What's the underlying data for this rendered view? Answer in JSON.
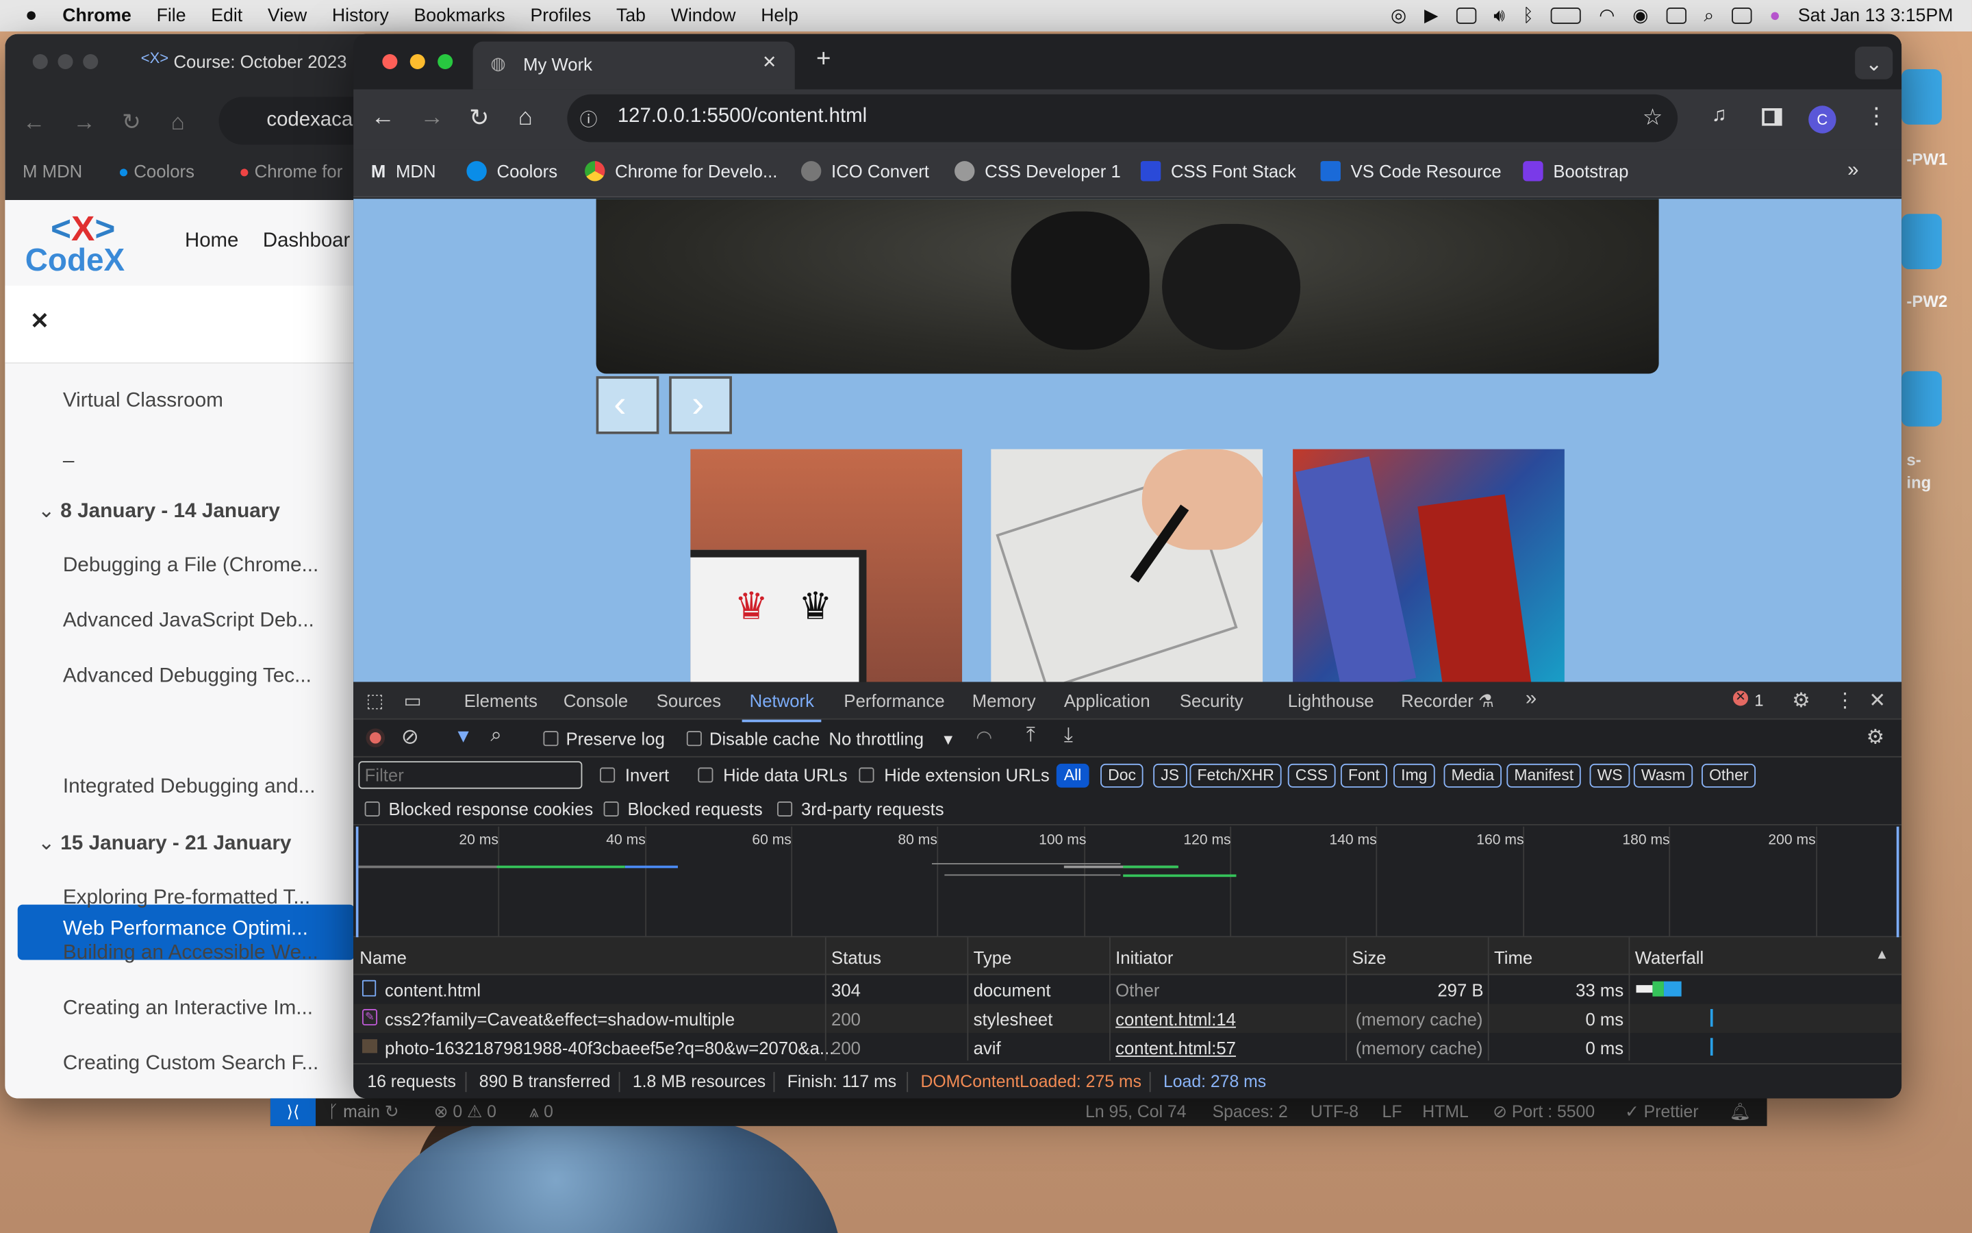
{
  "menubar": {
    "app": "Chrome",
    "items": [
      "File",
      "Edit",
      "View",
      "History",
      "Bookmarks",
      "Profiles",
      "Tab",
      "Window",
      "Help"
    ],
    "datetime": "Sat Jan 13  3:15PM"
  },
  "desktop": {
    "labels": [
      "-PW1",
      "-PW2",
      "s-",
      "ing"
    ]
  },
  "back_window": {
    "tab_title": "Course: October 2023",
    "address": "codexaca",
    "bookmarks": [
      "MDN",
      "Coolors",
      "Chrome for"
    ],
    "logo_text": "CodeX",
    "nav": [
      "Home",
      "Dashboar"
    ],
    "close_glyph": "✕",
    "items": [
      {
        "kind": "item",
        "label": "Virtual Classroom"
      },
      {
        "kind": "item",
        "label": "–"
      },
      {
        "kind": "section",
        "label": "8 January - 14 January"
      },
      {
        "kind": "item",
        "label": "Debugging a File (Chrome..."
      },
      {
        "kind": "item",
        "label": "Advanced JavaScript Deb..."
      },
      {
        "kind": "item",
        "label": "Advanced Debugging Tec..."
      },
      {
        "kind": "active",
        "label": "Web Performance Optimi..."
      },
      {
        "kind": "item",
        "label": "Integrated Debugging and..."
      },
      {
        "kind": "section",
        "label": "15 January - 21 January"
      },
      {
        "kind": "item",
        "label": "Exploring Pre-formatted T..."
      },
      {
        "kind": "item",
        "label": "Building an Accessible We..."
      },
      {
        "kind": "item",
        "label": "Creating an Interactive Im..."
      },
      {
        "kind": "item",
        "label": "Creating Custom Search F..."
      }
    ]
  },
  "browser": {
    "tab_title": "My Work",
    "url": "127.0.0.1:5500/content.html",
    "bookmarks": [
      {
        "label": "MDN",
        "color": "#222"
      },
      {
        "label": "Coolors",
        "color": "#0a8de8"
      },
      {
        "label": "Chrome for Develo...",
        "color": "#e44"
      },
      {
        "label": "ICO Convert",
        "color": "#888"
      },
      {
        "label": "CSS Developer 1",
        "color": "#888"
      },
      {
        "label": "CSS Font Stack",
        "color": "#2a4ad8"
      },
      {
        "label": "VS Code Resource",
        "color": "#1a6ad8"
      },
      {
        "label": "Bootstrap",
        "color": "#7a3ae8"
      }
    ],
    "profile_initial": "C"
  },
  "devtools": {
    "tabs": [
      "Elements",
      "Console",
      "Sources",
      "Network",
      "Performance",
      "Memory",
      "Application",
      "Security",
      "Lighthouse",
      "Recorder"
    ],
    "active_tab": "Network",
    "error_count": "1",
    "toolbar": {
      "preserve_log": "Preserve log",
      "disable_cache": "Disable cache",
      "throttling": "No throttling"
    },
    "filter_placeholder": "Filter",
    "filter_checks": [
      "Invert",
      "Hide data URLs",
      "Hide extension URLs"
    ],
    "chips": [
      "All",
      "Doc",
      "JS",
      "Fetch/XHR",
      "CSS",
      "Font",
      "Img",
      "Media",
      "Manifest",
      "WS",
      "Wasm",
      "Other"
    ],
    "row4_checks": [
      "Blocked response cookies",
      "Blocked requests",
      "3rd-party requests"
    ],
    "ticks": [
      "20 ms",
      "40 ms",
      "60 ms",
      "80 ms",
      "100 ms",
      "120 ms",
      "140 ms",
      "160 ms",
      "180 ms",
      "200 ms"
    ],
    "columns": [
      "Name",
      "Status",
      "Type",
      "Initiator",
      "Size",
      "Time",
      "Waterfall"
    ],
    "rows": [
      {
        "name": "content.html",
        "status": "304",
        "type": "document",
        "initiator": "Other",
        "size": "297 B",
        "time": "33 ms"
      },
      {
        "name": "css2?family=Caveat&effect=shadow-multiple",
        "status": "200",
        "type": "stylesheet",
        "initiator": "content.html:14",
        "size": "(memory cache)",
        "time": "0 ms"
      },
      {
        "name": "photo-1632187981988-40f3cbaeef5e?q=80&w=2070&a...",
        "status": "200",
        "type": "avif",
        "initiator": "content.html:57",
        "size": "(memory cache)",
        "time": "0 ms"
      }
    ],
    "status_bar": {
      "requests": "16 requests",
      "transferred": "890 B transferred",
      "resources": "1.8 MB resources",
      "finish": "Finish: 117 ms",
      "dcl": "DOMContentLoaded: 275 ms",
      "load": "Load: 278 ms"
    }
  },
  "vscode_status": {
    "branch": "main",
    "problems": "⊗ 0 ⚠ 0",
    "ports": "0",
    "cursor": "Ln 95, Col 74",
    "spaces": "Spaces: 2",
    "encoding": "UTF-8",
    "eol": "LF",
    "lang": "HTML",
    "port": "Port : 5500",
    "prettier": "Prettier"
  },
  "colors": {
    "active_blue": "#0a64c8",
    "dcl": "#f28b54",
    "load": "#8ab4f8",
    "page_bg": "#8ab8e6"
  }
}
